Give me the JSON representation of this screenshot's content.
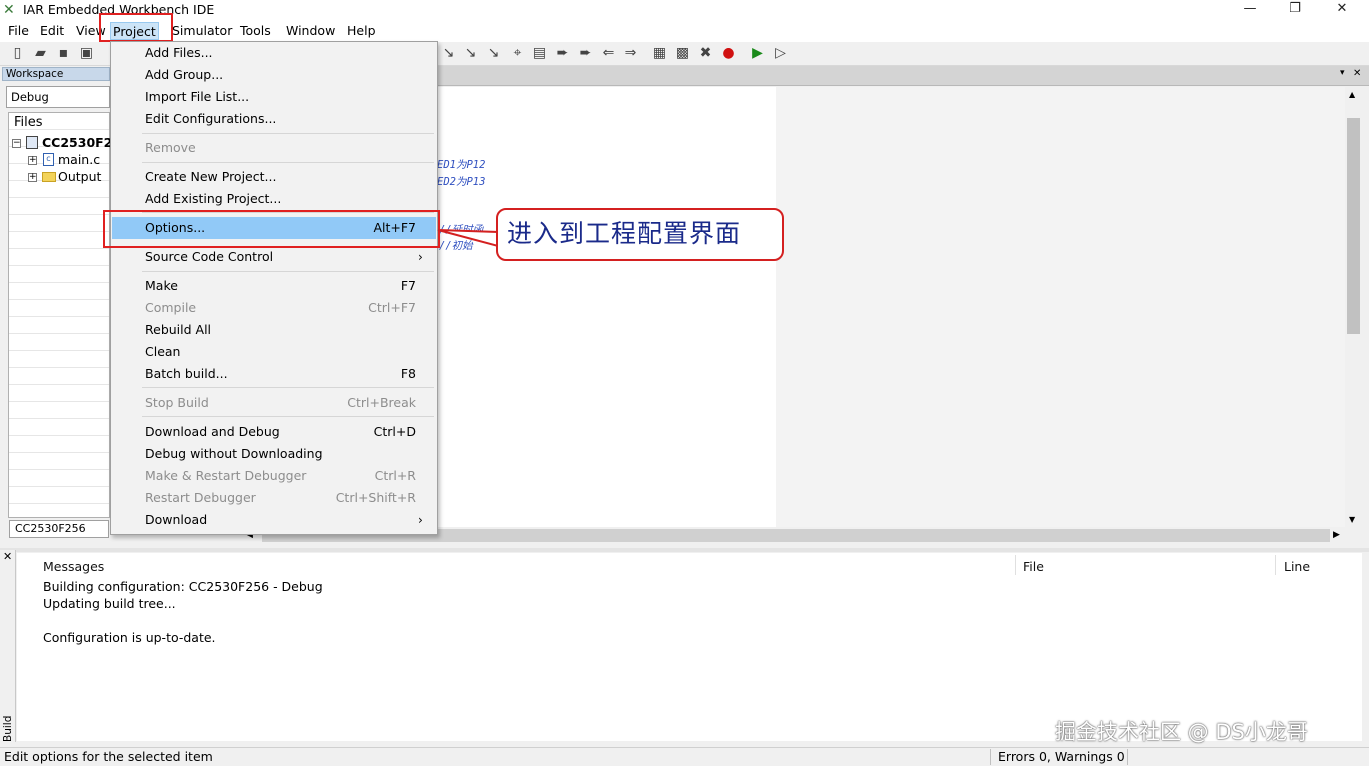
{
  "window": {
    "title": "IAR Embedded Workbench IDE",
    "minimize": "—",
    "restore": "❐",
    "close": "✕"
  },
  "menubar": [
    "File",
    "Edit",
    "View",
    "Project",
    "Simulator",
    "Tools",
    "Window",
    "Help"
  ],
  "workspace": {
    "title": "Workspace",
    "config": "Debug",
    "files_header": "Files",
    "project": "CC2530F2",
    "file": "main.c",
    "folder": "Output",
    "tab": "CC2530F256"
  },
  "editor": {
    "frag1": "ED1为P12",
    "frag2": "ED2为P13",
    "frag3": "//延时函",
    "frag4": "//初始"
  },
  "project_menu": {
    "items": [
      {
        "label": "Add Files...",
        "shortcut": "",
        "disabled": false
      },
      {
        "label": "Add Group...",
        "shortcut": "",
        "disabled": false
      },
      {
        "label": "Import File List...",
        "shortcut": "",
        "disabled": false
      },
      {
        "label": "Edit Configurations...",
        "shortcut": "",
        "disabled": false
      },
      {
        "label": "Remove",
        "shortcut": "",
        "disabled": true
      },
      {
        "label": "Create New Project...",
        "shortcut": "",
        "disabled": false
      },
      {
        "label": "Add Existing Project...",
        "shortcut": "",
        "disabled": false
      },
      {
        "label": "Options...",
        "shortcut": "Alt+F7",
        "disabled": false,
        "highlighted": true
      },
      {
        "label": "Source Code Control",
        "shortcut": "",
        "disabled": false,
        "submenu": true
      },
      {
        "label": "Make",
        "shortcut": "F7",
        "disabled": false
      },
      {
        "label": "Compile",
        "shortcut": "Ctrl+F7",
        "disabled": true
      },
      {
        "label": "Rebuild All",
        "shortcut": "",
        "disabled": false
      },
      {
        "label": "Clean",
        "shortcut": "",
        "disabled": false
      },
      {
        "label": "Batch build...",
        "shortcut": "F8",
        "disabled": false
      },
      {
        "label": "Stop Build",
        "shortcut": "Ctrl+Break",
        "disabled": true
      },
      {
        "label": "Download and Debug",
        "shortcut": "Ctrl+D",
        "disabled": false
      },
      {
        "label": "Debug without Downloading",
        "shortcut": "",
        "disabled": false
      },
      {
        "label": "Make & Restart Debugger",
        "shortcut": "Ctrl+R",
        "disabled": true
      },
      {
        "label": "Restart Debugger",
        "shortcut": "Ctrl+Shift+R",
        "disabled": true
      },
      {
        "label": "Download",
        "shortcut": "",
        "disabled": false,
        "submenu": true
      }
    ]
  },
  "callout": "进入到工程配置界面",
  "build": {
    "side_label": "Build",
    "columns": {
      "messages": "Messages",
      "file": "File",
      "line": "Line"
    },
    "lines": [
      "Building configuration: CC2530F256 - Debug",
      "Updating build tree...",
      "",
      "Configuration is up-to-date."
    ]
  },
  "statusbar": {
    "left": "Edit options for the selected item",
    "right": "Errors 0, Warnings 0"
  },
  "watermark": "掘金技术社区 @ DS小龙哥",
  "colors": {
    "highlight": "#91c9f7",
    "callout_border": "#d42020",
    "callout_text": "#1a2a8a",
    "red_box": "#e02020"
  }
}
